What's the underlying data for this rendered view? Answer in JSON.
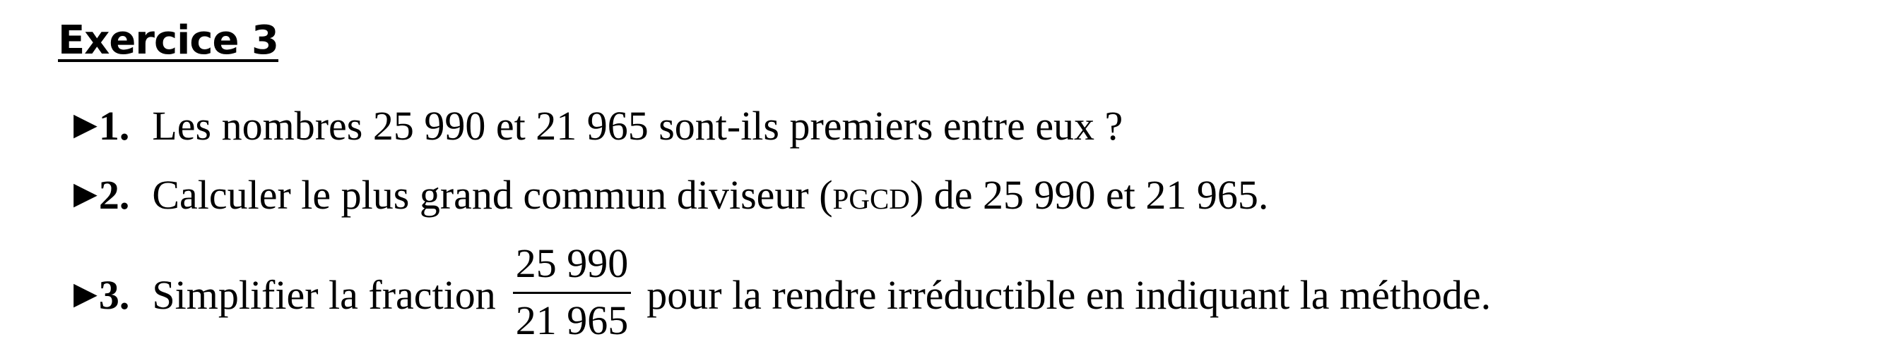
{
  "title": "Exercice 3",
  "marker_symbol": "▶",
  "items": [
    {
      "number": "1.",
      "text": "Les nombres 25 990 et 21 965 sont-ils premiers entre eux ?"
    },
    {
      "number": "2.",
      "text_before": "Calculer le plus grand commun diviseur (",
      "abbreviation": "pgcd",
      "text_after": ") de 25 990 et 21 965."
    },
    {
      "number": "3.",
      "text_before": "Simplifier la fraction",
      "fraction": {
        "numerator": "25 990",
        "denominator": "21 965"
      },
      "text_after": "pour la rendre irréductible en indiquant la méthode."
    }
  ]
}
